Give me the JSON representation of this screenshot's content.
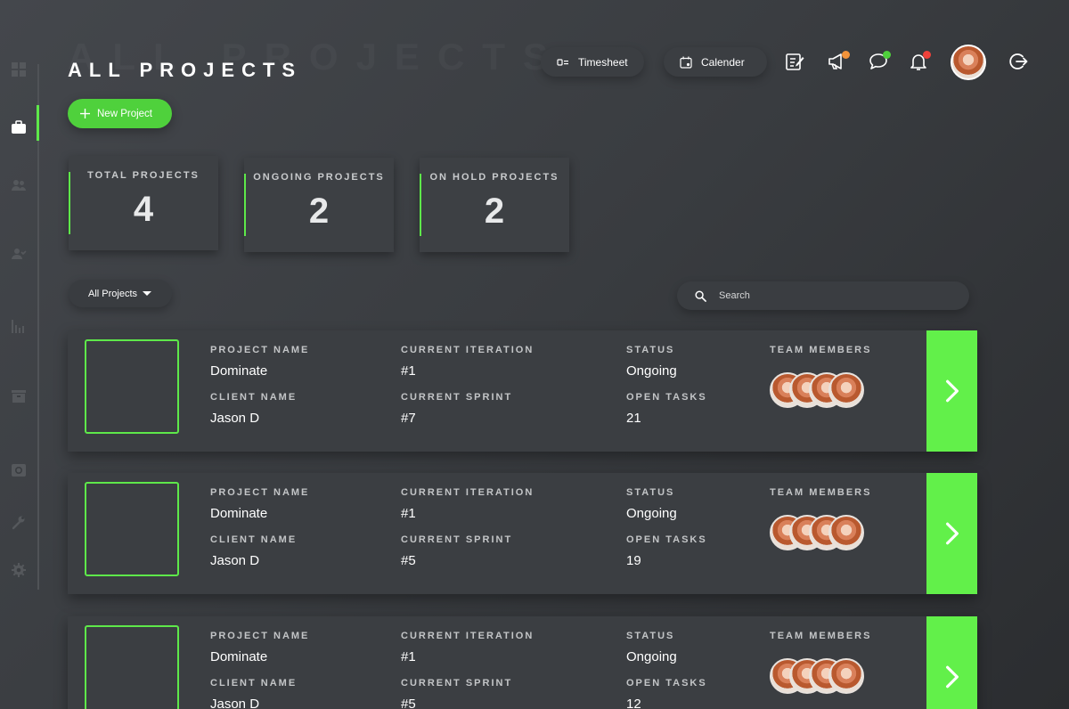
{
  "page": {
    "title": "ALL PROJECTS",
    "title_ghost": "ALL PROJECTS"
  },
  "topbar": {
    "timesheet_label": "Timesheet",
    "calendar_label": "Calender",
    "notification_colors": {
      "megaphone": "#f2933a",
      "chat": "#4fd13c",
      "bell": "#f0413a"
    }
  },
  "actions": {
    "new_project_label": "New Project"
  },
  "stats": [
    {
      "label": "TOTAL PROJECTS",
      "value": "4"
    },
    {
      "label": "ONGOING PROJECTS",
      "value": "2"
    },
    {
      "label": "ON HOLD PROJECTS",
      "value": "2"
    }
  ],
  "filter": {
    "selected": "All Projects"
  },
  "search": {
    "placeholder": "Search"
  },
  "labels": {
    "project_name": "PROJECT NAME",
    "client_name": "CLIENT NAME",
    "current_iteration": "CURRENT ITERATION",
    "current_sprint": "CURRENT SPRINT",
    "status": "STATUS",
    "open_tasks": "OPEN TASKS",
    "team_members": "TEAM MEMBERS"
  },
  "projects": [
    {
      "name": "Dominate",
      "client": "Jason D",
      "iteration": "#1",
      "sprint": "#7",
      "status": "Ongoing",
      "open_tasks": "21"
    },
    {
      "name": "Dominate",
      "client": "Jason D",
      "iteration": "#1",
      "sprint": "#5",
      "status": "Ongoing",
      "open_tasks": "19"
    },
    {
      "name": "Dominate",
      "client": "Jason D",
      "iteration": "#1",
      "sprint": "#5",
      "status": "Ongoing",
      "open_tasks": "12"
    }
  ],
  "colors": {
    "accent": "#5ee84a",
    "card": "#3b3e42",
    "background": "#3a3d41"
  }
}
